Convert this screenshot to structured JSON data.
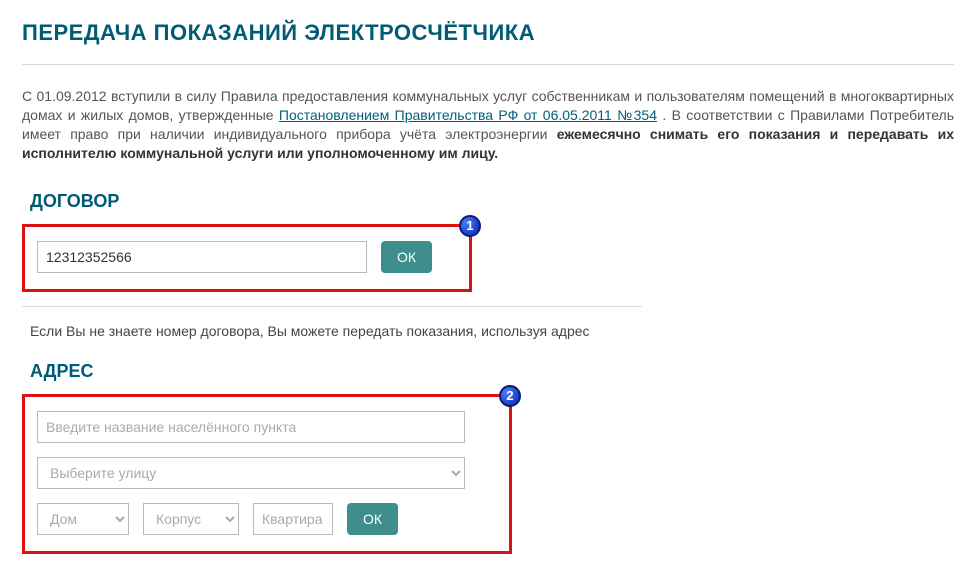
{
  "page_title": "ПЕРЕДАЧА ПОКАЗАНИЙ ЭЛЕКТРОСЧЁТЧИКА",
  "intro": {
    "part1": "С 01.09.2012 вступили в силу Правила предоставления коммунальных услуг собственникам и пользователям помещений в многоквартирных домах и жилых домов, утвержденные ",
    "link_text": "Постановлением Правительства РФ от 06.05.2011 №354",
    "part2": ". В соответствии с Правилами Потребитель имеет право при наличии индивидуального прибора учёта электроэнергии ",
    "bold": "ежемесячно снимать его показания и передавать их исполнителю коммунальной услуги или уполномоченному им лицу."
  },
  "contract": {
    "heading": "ДОГОВОР",
    "badge": "1",
    "value": "12312352566",
    "ok_label": "ОК"
  },
  "hint": "Если Вы не знаете номер договора, Вы можете передать показания, используя адрес",
  "address": {
    "heading": "АДРЕС",
    "badge": "2",
    "locality_placeholder": "Введите название населённого пункта",
    "street_placeholder": "Выберите улицу",
    "house_placeholder": "Дом",
    "block_placeholder": "Корпус",
    "apt_placeholder": "Квартира",
    "ok_label": "ОК"
  }
}
